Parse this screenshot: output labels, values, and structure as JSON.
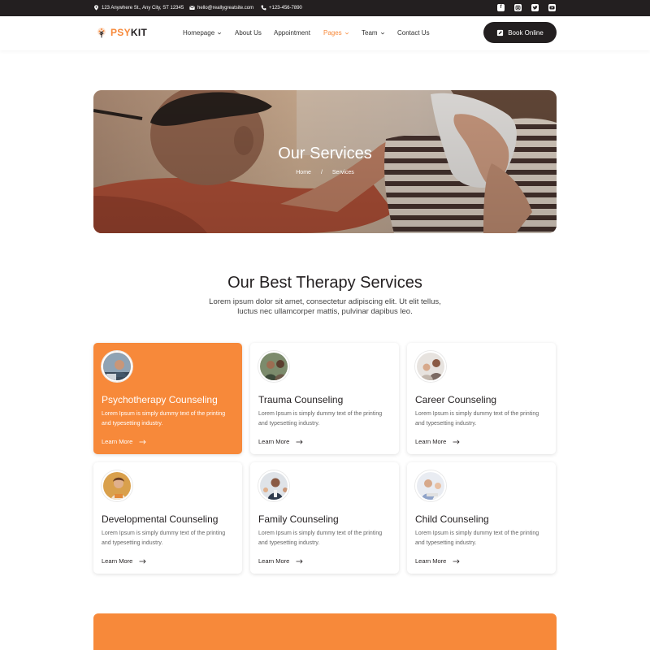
{
  "topbar": {
    "address": "123 Anywhere St., Any City, ST 12345",
    "email": "hello@reallygreatsite.com",
    "phone": "+123-456-7890",
    "social_icons": [
      "facebook-icon",
      "instagram-icon",
      "twitter-icon",
      "youtube-icon"
    ]
  },
  "nav": {
    "logo_psy": "PSY",
    "logo_kit": "KIT",
    "items": [
      {
        "label": "Homepage",
        "dropdown": true
      },
      {
        "label": "About Us",
        "dropdown": false
      },
      {
        "label": "Appointment",
        "dropdown": false
      },
      {
        "label": "Pages",
        "dropdown": true,
        "active": true
      },
      {
        "label": "Team",
        "dropdown": true
      },
      {
        "label": "Contact Us",
        "dropdown": false
      }
    ],
    "book_label": "Book Online"
  },
  "hero": {
    "title": "Our Services",
    "breadcrumb": [
      "Home",
      "/",
      "Services"
    ]
  },
  "section": {
    "title": "Our Best Therapy Services",
    "subtitle": "Lorem ipsum dolor sit amet, consectetur adipiscing elit. Ut elit tellus, luctus nec ullamcorper mattis, pulvinar dapibus leo."
  },
  "cards": [
    {
      "title": "Psychotherapy Counseling",
      "desc": "Lorem Ipsum is simply dummy text of the printing and typesetting industry.",
      "link": "Learn More"
    },
    {
      "title": "Trauma Counseling",
      "desc": "Lorem Ipsum is simply dummy text of the printing and typesetting industry.",
      "link": "Learn More"
    },
    {
      "title": "Career Counseling",
      "desc": "Lorem Ipsum is simply dummy text of the printing and typesetting industry.",
      "link": "Learn More"
    },
    {
      "title": "Developmental Counseling",
      "desc": "Lorem Ipsum is simply dummy text of the printing and typesetting industry.",
      "link": "Learn More"
    },
    {
      "title": "Family Counseling",
      "desc": "Lorem Ipsum is simply dummy text of the printing and typesetting industry.",
      "link": "Learn More"
    },
    {
      "title": "Child Counseling",
      "desc": "Lorem Ipsum is simply dummy text of the printing and typesetting industry.",
      "link": "Learn More"
    }
  ],
  "colors": {
    "accent": "#f7893a",
    "dark": "#231f20"
  }
}
